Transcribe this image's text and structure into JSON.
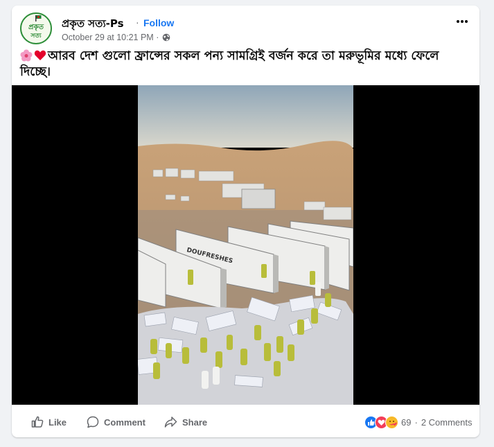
{
  "post": {
    "author": "প্রকৃত সত্য-Ps",
    "separator": "·",
    "follow_label": "Follow",
    "date": "October 29 at 10:21 PM ·",
    "text": "আরব দেশ গুলো ফ্রান্সের সকল পন্য সামগ্রিই বর্জন করে তা মরুভূমির মধ্যে ফেলে দিচ্ছে।",
    "avatar_text_top": "প্রকৃত",
    "avatar_text_bottom": "সত্য",
    "video_truck_text": "DOUFRESHES"
  },
  "actions": {
    "like_label": "Like",
    "comment_label": "Comment",
    "share_label": "Share"
  },
  "reactions": {
    "count": "69",
    "separator": "·",
    "comments": "2 Comments",
    "types": [
      "like-icon",
      "love-icon",
      "care-icon"
    ]
  },
  "colors": {
    "accent": "#1877f2",
    "text_secondary": "#65676b",
    "background": "#f0f2f5"
  }
}
